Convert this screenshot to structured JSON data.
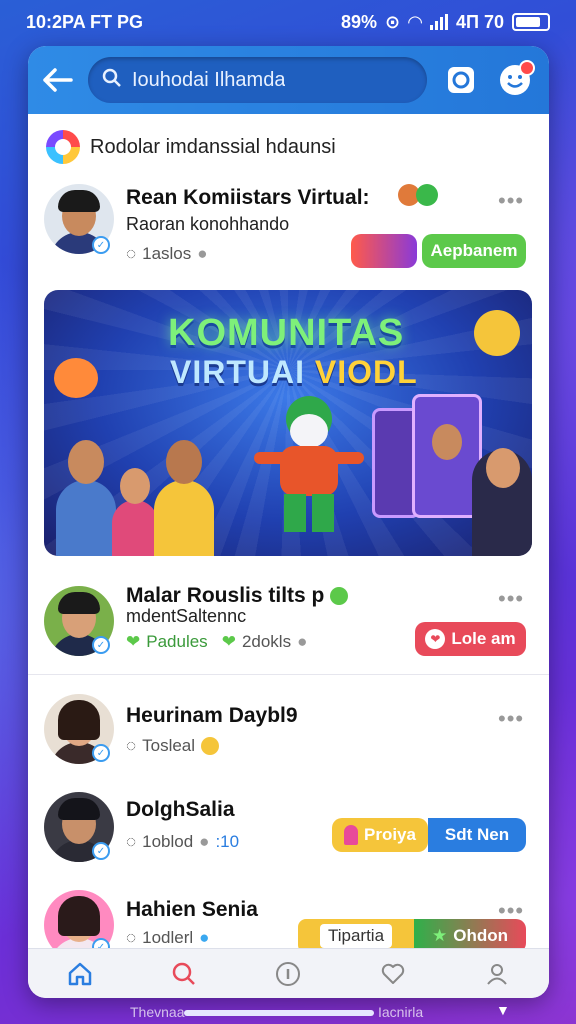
{
  "status_bar": {
    "time": "10:2PA FT PG",
    "right_text": "89%",
    "network": "4Π 70"
  },
  "search": {
    "value": "Iouhodai Ilhamda"
  },
  "section": {
    "title": "Rodolar imdanssial hdaunsi"
  },
  "posts": [
    {
      "name": "Rean Komiistars Virtual:",
      "subtitle": "Raoran konohhando",
      "meta": "1aslos",
      "action_label": "Aepbanem",
      "more": "•••"
    },
    {
      "name": "Malar Rouslis tilts p",
      "subtitle": "mdentSaltennc",
      "meta_a": "Padules",
      "meta_b": "2dokls",
      "action_label": "Lole am",
      "more": "•••"
    },
    {
      "name": "Heurinam Daybl9",
      "meta": "Tosleal",
      "more": "•••"
    },
    {
      "name": "DolghSalia",
      "meta": "1oblod",
      "meta_extra": ":10",
      "action_a": "Proiya",
      "action_b": "Sdt Nen"
    },
    {
      "name": "Hahien Senia",
      "meta": "1odlerl",
      "action_a": "Tipartia",
      "action_b": "Ohdon",
      "more": "•••"
    }
  ],
  "banner": {
    "line1": "KOMUNITAS",
    "line2a": "VIRTUAI",
    "line2b": "VIODL"
  },
  "footer": {
    "left": "Thevnaa",
    "right": "Iacnirla"
  },
  "colors": {
    "primary": "#2f8be6",
    "green": "#5cc94a",
    "red": "#e84a5a",
    "yellow": "#f5c53a",
    "blue": "#2a7de0"
  },
  "icons": [
    "back-icon",
    "search-icon",
    "camera-icon",
    "profile-icon",
    "home-icon",
    "search-nav-icon",
    "info-icon",
    "heart-icon",
    "user-icon"
  ]
}
